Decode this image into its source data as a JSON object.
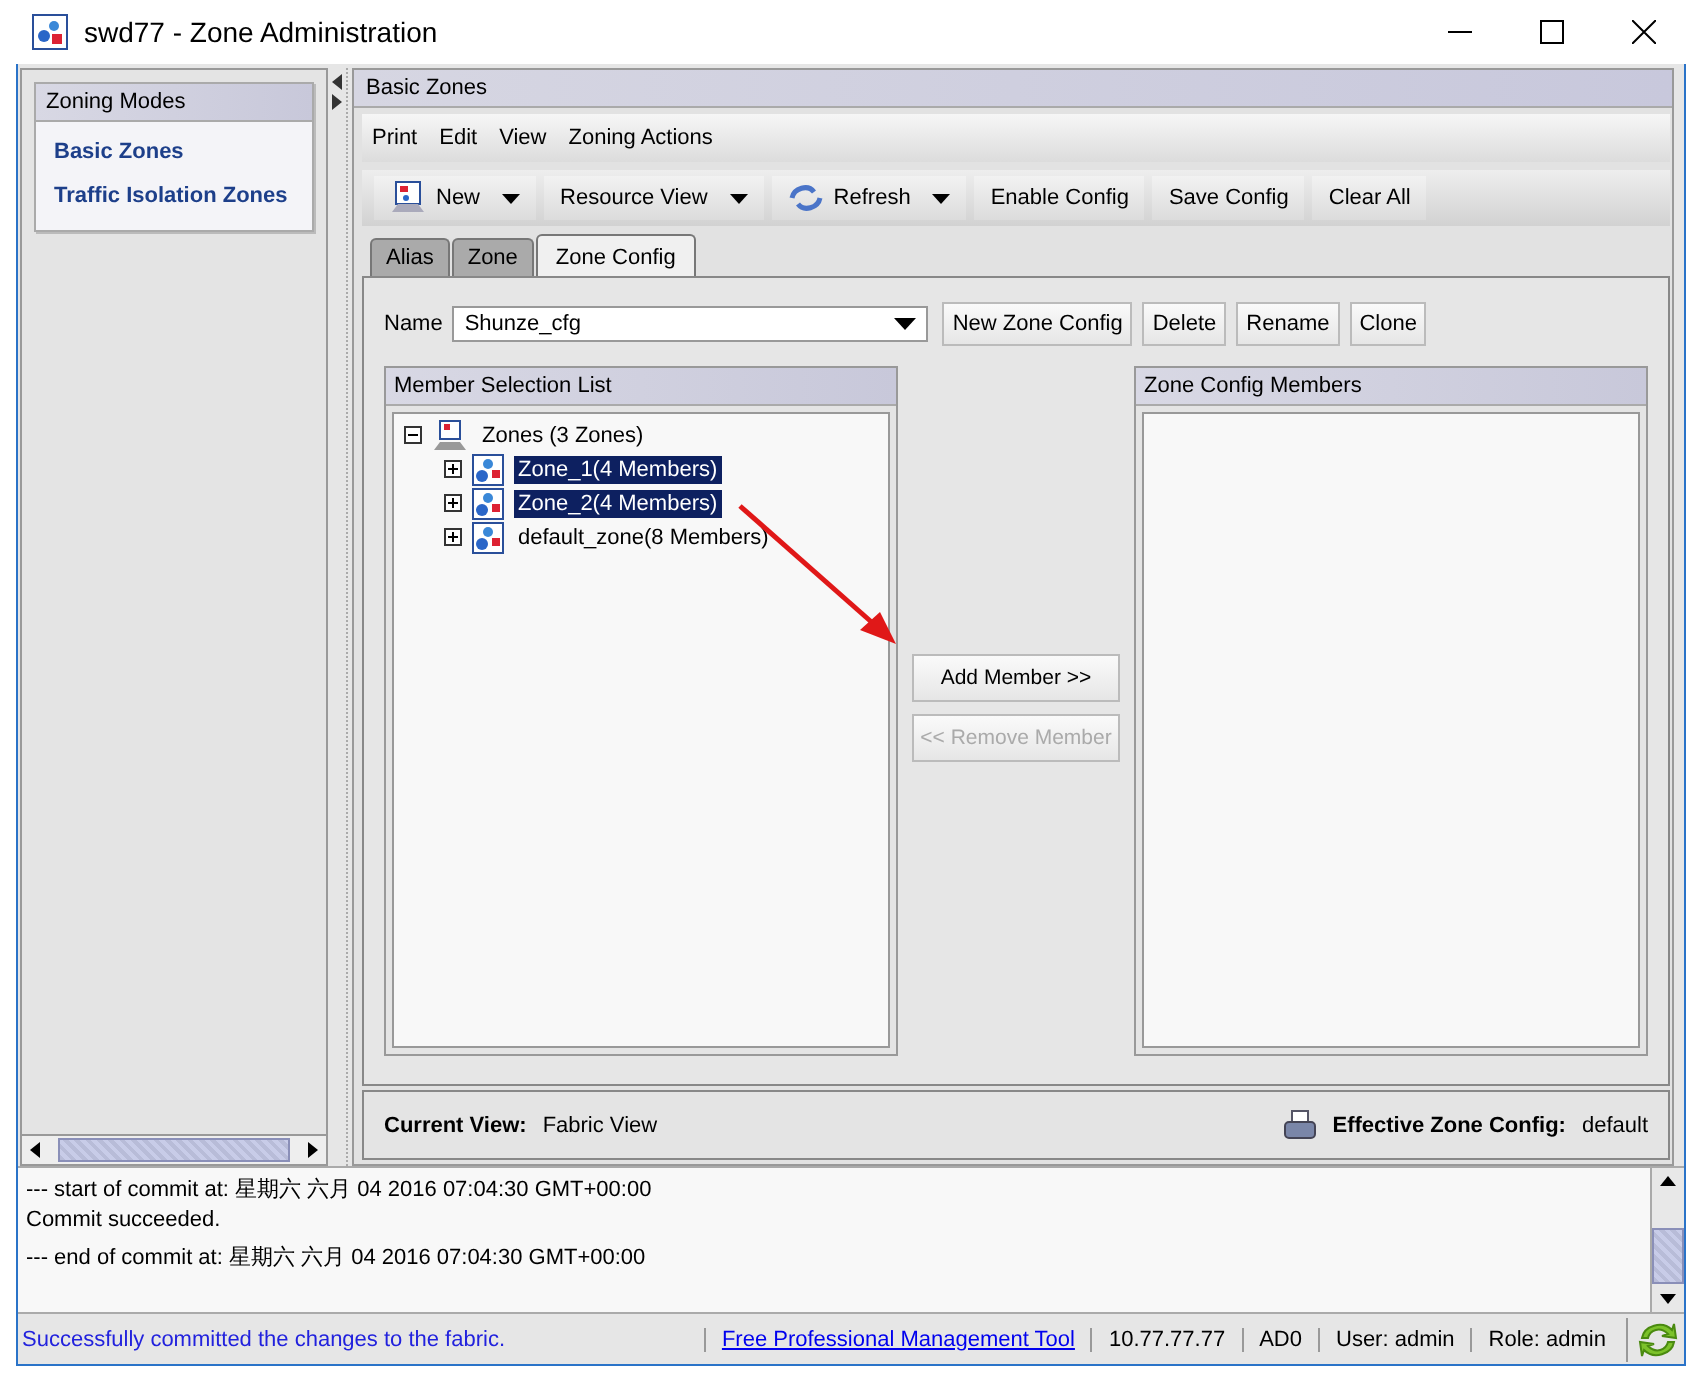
{
  "window": {
    "title": "swd77 - Zone Administration"
  },
  "sidebar": {
    "title": "Zoning Modes",
    "items": [
      "Basic Zones",
      "Traffic Isolation Zones"
    ]
  },
  "panel": {
    "title": "Basic Zones"
  },
  "menu": [
    "Print",
    "Edit",
    "View",
    "Zoning Actions"
  ],
  "toolbar": [
    {
      "label": "New",
      "kind": "new",
      "dropdown": true
    },
    {
      "label": "Resource View",
      "kind": "plain",
      "dropdown": true
    },
    {
      "label": "Refresh",
      "kind": "refresh",
      "dropdown": true
    },
    {
      "label": "Enable Config",
      "kind": "plain",
      "dropdown": false
    },
    {
      "label": "Save Config",
      "kind": "plain",
      "dropdown": false
    },
    {
      "label": "Clear All",
      "kind": "plain",
      "dropdown": false
    }
  ],
  "tabs": [
    {
      "label": "Alias",
      "selected": false
    },
    {
      "label": "Zone",
      "selected": false
    },
    {
      "label": "Zone Config",
      "selected": true
    }
  ],
  "name_field": {
    "label": "Name",
    "value": "Shunze_cfg"
  },
  "config_buttons": [
    "New Zone Config",
    "Delete",
    "Rename",
    "Clone"
  ],
  "member_list": {
    "title": "Member Selection List",
    "tree": [
      {
        "label": "Zones (3 Zones)",
        "expanded": true,
        "selected": false,
        "children": [
          {
            "label": "Zone_1(4 Members)",
            "expanded": false,
            "selected": true
          },
          {
            "label": "Zone_2(4 Members)",
            "expanded": false,
            "selected": true
          },
          {
            "label": "default_zone(8 Members)",
            "expanded": false,
            "selected": false
          }
        ]
      }
    ]
  },
  "transfer_buttons": [
    {
      "label": "Add Member >>",
      "disabled": false
    },
    {
      "label": "<< Remove Member",
      "disabled": true
    }
  ],
  "config_members": {
    "title": "Zone Config Members"
  },
  "footer": {
    "current_view_label": "Current View:",
    "current_view": "Fabric View",
    "effective_label": "Effective Zone Config:",
    "effective": "default"
  },
  "log": [
    "--- start of commit at: 星期六 六月 04 2016 07:04:30 GMT+00:00",
    "Commit succeeded.",
    "--- end of commit at: 星期六 六月 04 2016 07:04:30 GMT+00:00"
  ],
  "status_bar": {
    "message": "Successfully committed the changes to the fabric.",
    "link": "Free Professional Management Tool",
    "fields": [
      "10.77.77.77",
      "AD0",
      "User: admin",
      "Role: admin"
    ]
  }
}
